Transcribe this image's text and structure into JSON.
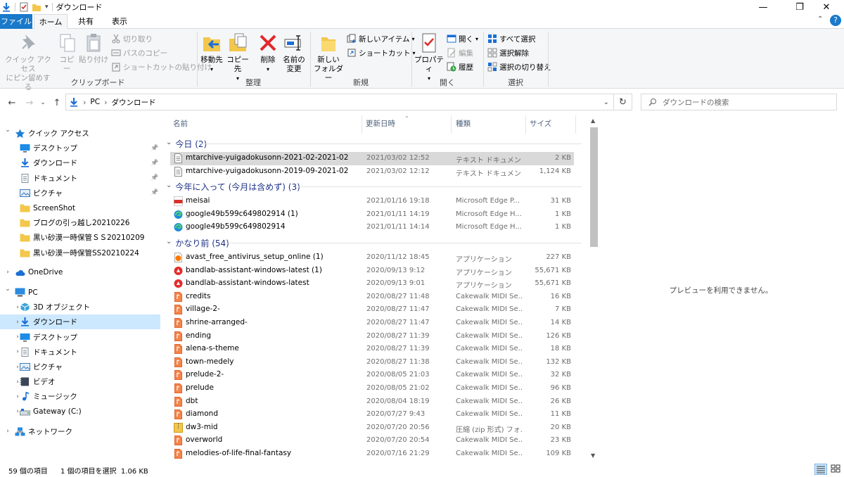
{
  "window": {
    "title": "ダウンロード",
    "controls": {
      "minimize": "—",
      "maximize": "❐",
      "close": "✕"
    }
  },
  "tabs": [
    {
      "label": "ファイル"
    },
    {
      "label": "ホーム"
    },
    {
      "label": "共有"
    },
    {
      "label": "表示"
    }
  ],
  "help_label": "?",
  "ribbon": {
    "groups": {
      "clipboard": "クリップボード",
      "organize": "整理",
      "new": "新規",
      "open": "開く",
      "select": "選択"
    },
    "pin_quick_access": {
      "line1": "クイック アクセス",
      "line2": "にピン留めする"
    },
    "copy": "コピー",
    "paste": "貼り付け",
    "cut": "切り取り",
    "copy_path": "パスのコピー",
    "paste_shortcut": "ショートカットの貼り付け",
    "move_to": "移動先",
    "copy_to": "コピー先",
    "delete": "削除",
    "rename": {
      "line1": "名前の",
      "line2": "変更"
    },
    "new_folder": {
      "line1": "新しい",
      "line2": "フォルダー"
    },
    "new_item": "新しいアイテム",
    "shortcut": "ショートカット",
    "properties": "プロパティ",
    "open": "開く",
    "edit": "編集",
    "history": "履歴",
    "select_all": "すべて選択",
    "select_none": "選択解除",
    "invert_selection": "選択の切り替え"
  },
  "address": {
    "crumbs": [
      "PC",
      "ダウンロード"
    ],
    "search_placeholder": "ダウンロードの検索"
  },
  "nav": {
    "items": [
      {
        "label": "クイック アクセス",
        "level": 0,
        "chev": "v",
        "icon": "star-icon",
        "color": "#1e7fd6"
      },
      {
        "label": "デスクトップ",
        "level": 1,
        "icon": "desktop-icon",
        "color": "#1c8ce6",
        "pinned": true
      },
      {
        "label": "ダウンロード",
        "level": 1,
        "icon": "download-icon",
        "color": "#1a6fd6",
        "pinned": true
      },
      {
        "label": "ドキュメント",
        "level": 1,
        "icon": "document-icon",
        "color": "#7f8c98",
        "pinned": true
      },
      {
        "label": "ピクチャ",
        "level": 1,
        "icon": "pictures-icon",
        "color": "#3a7bbf",
        "pinned": true
      },
      {
        "label": "ScreenShot",
        "level": 1,
        "icon": "folder-icon",
        "color": "#f3c74b"
      },
      {
        "label": "ブログの引っ越し20210226",
        "level": 1,
        "icon": "folder-icon",
        "color": "#f3c74b"
      },
      {
        "label": "黒い砂漠一時保管ＳＳ20210209",
        "level": 1,
        "icon": "folder-icon",
        "color": "#f3c74b"
      },
      {
        "label": "黒い砂漠一時保管SS20210224",
        "level": 1,
        "icon": "folder-icon",
        "color": "#f3c74b"
      },
      {
        "label": "",
        "spacer": true
      },
      {
        "label": "OneDrive",
        "level": 0,
        "chev": ">",
        "icon": "cloud-icon",
        "color": "#1a6fd6"
      },
      {
        "label": "",
        "spacer": true
      },
      {
        "label": "PC",
        "level": 0,
        "chev": "v",
        "icon": "pc-icon",
        "color": "#2b8be0"
      },
      {
        "label": "3D オブジェクト",
        "level": 1,
        "chev": ">",
        "icon": "cube-icon",
        "color": "#3aa3d8"
      },
      {
        "label": "ダウンロード",
        "level": 1,
        "chev": ">",
        "icon": "download-icon",
        "color": "#1a6fd6",
        "selected": true
      },
      {
        "label": "デスクトップ",
        "level": 1,
        "chev": ">",
        "icon": "desktop-icon",
        "color": "#1c8ce6"
      },
      {
        "label": "ドキュメント",
        "level": 1,
        "chev": ">",
        "icon": "document-icon",
        "color": "#7f8c98"
      },
      {
        "label": "ピクチャ",
        "level": 1,
        "chev": ">",
        "icon": "pictures-icon",
        "color": "#3a7bbf"
      },
      {
        "label": "ビデオ",
        "level": 1,
        "chev": ">",
        "icon": "video-icon",
        "color": "#3b4658"
      },
      {
        "label": "ミュージック",
        "level": 1,
        "chev": ">",
        "icon": "music-icon",
        "color": "#1a6fd6"
      },
      {
        "label": "Gateway (C:)",
        "level": 1,
        "chev": ">",
        "icon": "drive-icon",
        "color": "#7f8c98"
      },
      {
        "label": "",
        "spacer": true
      },
      {
        "label": "ネットワーク",
        "level": 0,
        "chev": ">",
        "icon": "network-icon",
        "color": "#2b8be0"
      }
    ]
  },
  "columns": [
    {
      "label": "名前"
    },
    {
      "label": "更新日時"
    },
    {
      "label": "種類"
    },
    {
      "label": "サイズ"
    }
  ],
  "groups": [
    {
      "label": "今日 (2)",
      "files": [
        {
          "name": "mtarchive-yuigadokusonn-2021-02-2021-02",
          "date": "2021/03/02 12:52",
          "type": "テキスト ドキュメント",
          "size": "2 KB",
          "icon": "text-file-icon",
          "selected": true
        },
        {
          "name": "mtarchive-yuigadokusonn-2019-09-2021-02",
          "date": "2021/03/02 12:12",
          "type": "テキスト ドキュメント",
          "size": "1,124 KB",
          "icon": "text-file-icon"
        }
      ]
    },
    {
      "label": "今年に入って (今月は含めず) (3)",
      "files": [
        {
          "name": "meisai",
          "date": "2021/01/16 19:18",
          "type": "Microsoft Edge P...",
          "size": "31 KB",
          "icon": "pdf-icon"
        },
        {
          "name": "google49b599c649802914 (1)",
          "date": "2021/01/11 14:19",
          "type": "Microsoft Edge H...",
          "size": "1 KB",
          "icon": "edge-icon"
        },
        {
          "name": "google49b599c649802914",
          "date": "2021/01/11 14:14",
          "type": "Microsoft Edge H...",
          "size": "1 KB",
          "icon": "edge-icon"
        }
      ]
    },
    {
      "label": "かなり前 (54)",
      "files": [
        {
          "name": "avast_free_antivirus_setup_online (1)",
          "date": "2020/11/12 18:45",
          "type": "アプリケーション",
          "size": "227 KB",
          "icon": "avast-icon"
        },
        {
          "name": "bandlab-assistant-windows-latest (1)",
          "date": "2020/09/13 9:12",
          "type": "アプリケーション",
          "size": "55,671 KB",
          "icon": "bandlab-icon"
        },
        {
          "name": "bandlab-assistant-windows-latest",
          "date": "2020/09/13 9:01",
          "type": "アプリケーション",
          "size": "55,671 KB",
          "icon": "bandlab-icon"
        },
        {
          "name": "credits",
          "date": "2020/08/27 11:48",
          "type": "Cakewalk MIDI Se...",
          "size": "16 KB",
          "icon": "midi-icon"
        },
        {
          "name": "village-2-",
          "date": "2020/08/27 11:47",
          "type": "Cakewalk MIDI Se...",
          "size": "7 KB",
          "icon": "midi-icon"
        },
        {
          "name": "shrine-arranged-",
          "date": "2020/08/27 11:47",
          "type": "Cakewalk MIDI Se...",
          "size": "14 KB",
          "icon": "midi-icon"
        },
        {
          "name": "ending",
          "date": "2020/08/27 11:39",
          "type": "Cakewalk MIDI Se...",
          "size": "126 KB",
          "icon": "midi-icon"
        },
        {
          "name": "alena-s-theme",
          "date": "2020/08/27 11:39",
          "type": "Cakewalk MIDI Se...",
          "size": "18 KB",
          "icon": "midi-icon"
        },
        {
          "name": "town-medely",
          "date": "2020/08/27 11:38",
          "type": "Cakewalk MIDI Se...",
          "size": "132 KB",
          "icon": "midi-icon"
        },
        {
          "name": "prelude-2-",
          "date": "2020/08/05 21:03",
          "type": "Cakewalk MIDI Se...",
          "size": "32 KB",
          "icon": "midi-icon"
        },
        {
          "name": "prelude",
          "date": "2020/08/05 21:02",
          "type": "Cakewalk MIDI Se...",
          "size": "96 KB",
          "icon": "midi-icon"
        },
        {
          "name": "dbt",
          "date": "2020/08/04 18:19",
          "type": "Cakewalk MIDI Se...",
          "size": "26 KB",
          "icon": "midi-icon"
        },
        {
          "name": "diamond",
          "date": "2020/07/27 9:43",
          "type": "Cakewalk MIDI Se...",
          "size": "11 KB",
          "icon": "midi-icon"
        },
        {
          "name": "dw3-mid",
          "date": "2020/07/20 20:56",
          "type": "圧縮 (zip 形式) フォ...",
          "size": "20 KB",
          "icon": "zip-icon"
        },
        {
          "name": "overworld",
          "date": "2020/07/20 20:54",
          "type": "Cakewalk MIDI Se...",
          "size": "23 KB",
          "icon": "midi-icon"
        },
        {
          "name": "melodies-of-life-final-fantasy",
          "date": "2020/07/16 21:29",
          "type": "Cakewalk MIDI Se...",
          "size": "109 KB",
          "icon": "midi-icon"
        }
      ]
    }
  ],
  "preview": {
    "message": "プレビューを利用できません。"
  },
  "status": {
    "item_count": "59 個の項目",
    "selection": "1 個の項目を選択  1.06 KB"
  },
  "colors": {
    "accent": "#1979ca",
    "selection": "#cce8ff",
    "group_header": "#1e3287"
  }
}
